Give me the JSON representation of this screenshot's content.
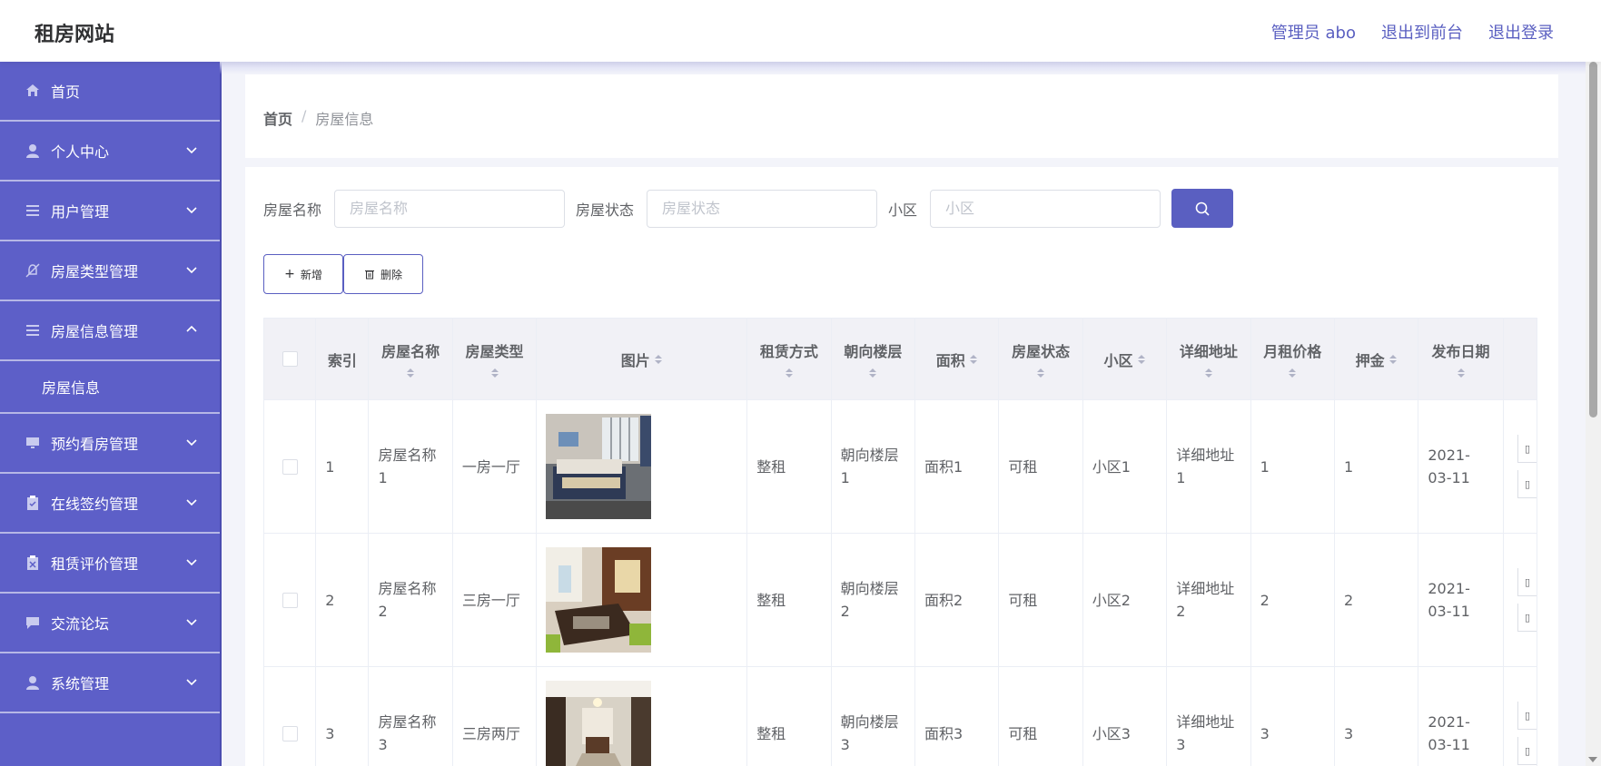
{
  "header": {
    "site_title": "租房网站",
    "links": [
      "管理员 abo",
      "退出到前台",
      "退出登录"
    ]
  },
  "sidebar": {
    "items": [
      {
        "label": "首页",
        "icon": "home-icon"
      },
      {
        "label": "个人中心",
        "icon": "user-icon"
      },
      {
        "label": "用户管理",
        "icon": "list-icon"
      },
      {
        "label": "房屋类型管理",
        "icon": "bell-off-icon"
      },
      {
        "label": "房屋信息管理",
        "icon": "list-icon"
      },
      {
        "label": "房屋信息",
        "sub": true
      },
      {
        "label": "预约看房管理",
        "icon": "monitor-icon"
      },
      {
        "label": "在线签约管理",
        "icon": "clipboard-icon"
      },
      {
        "label": "租赁评价管理",
        "icon": "clipboard-x-icon"
      },
      {
        "label": "交流论坛",
        "icon": "chat-icon"
      },
      {
        "label": "系统管理",
        "icon": "user-icon"
      }
    ]
  },
  "breadcrumb": {
    "home": "首页",
    "separator": "/",
    "current": "房屋信息"
  },
  "search": {
    "fields": [
      {
        "label": "房屋名称",
        "placeholder": "房屋名称"
      },
      {
        "label": "房屋状态",
        "placeholder": "房屋状态"
      },
      {
        "label": "小区",
        "placeholder": "小区"
      }
    ]
  },
  "actions": {
    "add_label": "新增",
    "delete_label": "删除"
  },
  "table": {
    "columns": [
      "索引",
      "房屋名称",
      "房屋类型",
      "图片",
      "租赁方式",
      "朝向楼层",
      "面积",
      "房屋状态",
      "小区",
      "详细地址",
      "月租价格",
      "押金",
      "发布日期"
    ],
    "rows": [
      {
        "index": "1",
        "name": "房屋名称1",
        "type": "一房一厅",
        "image": "bedroom",
        "rent_mode": "整租",
        "floor": "朝向楼层1",
        "area": "面积1",
        "status": "可租",
        "community": "小区1",
        "address": "详细地址1",
        "price": "1",
        "deposit": "1",
        "date": "2021-03-11"
      },
      {
        "index": "2",
        "name": "房屋名称2",
        "type": "三房一厅",
        "image": "dining",
        "rent_mode": "整租",
        "floor": "朝向楼层2",
        "area": "面积2",
        "status": "可租",
        "community": "小区2",
        "address": "详细地址2",
        "price": "2",
        "deposit": "2",
        "date": "2021-03-11"
      },
      {
        "index": "3",
        "name": "房屋名称3",
        "type": "三房两厅",
        "image": "hallway",
        "rent_mode": "整租",
        "floor": "朝向楼层3",
        "area": "面积3",
        "status": "可租",
        "community": "小区3",
        "address": "详细地址3",
        "price": "3",
        "deposit": "3",
        "date": "2021-03-11"
      }
    ]
  },
  "colors": {
    "accent": "#5a5fc1",
    "sidebar_bg": "#5d5fc8"
  }
}
